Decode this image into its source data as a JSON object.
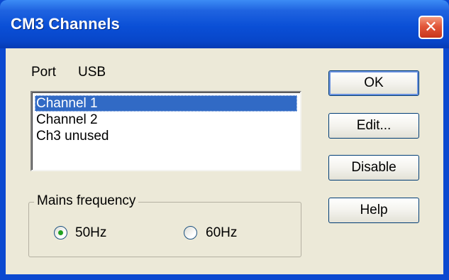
{
  "window": {
    "title": "CM3 Channels",
    "close_icon": "close-x-icon",
    "close_glyph": "✕"
  },
  "port": {
    "label": "Port",
    "value": "USB"
  },
  "channels": {
    "items": [
      {
        "label": "Channel 1",
        "selected": true
      },
      {
        "label": "Channel 2",
        "selected": false
      },
      {
        "label": "Ch3 unused",
        "selected": false
      }
    ]
  },
  "mains": {
    "title": "Mains frequency",
    "options": [
      {
        "label": "50Hz",
        "checked": true
      },
      {
        "label": "60Hz",
        "checked": false
      }
    ]
  },
  "buttons": {
    "ok": "OK",
    "edit": "Edit...",
    "disable": "Disable",
    "help": "Help"
  },
  "colors": {
    "titlebar": "#0a4fd6",
    "selection": "#316ac5",
    "dialog_bg": "#ece9d8",
    "radio_dot": "#21a121",
    "close_button": "#e2573a"
  }
}
